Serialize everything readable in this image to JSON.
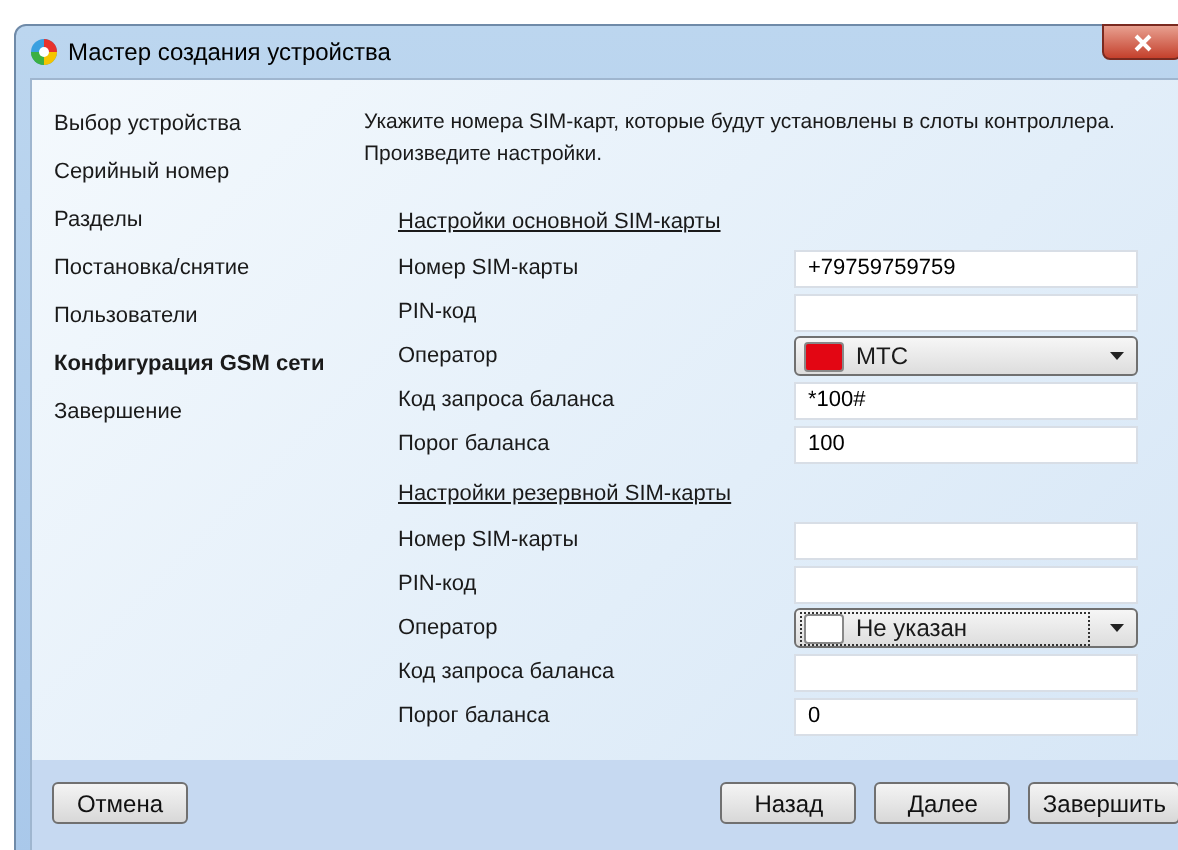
{
  "window": {
    "title": "Мастер создания устройства"
  },
  "sidebar": {
    "items": [
      {
        "label": "Выбор устройства",
        "selected": false
      },
      {
        "label": "Серийный номер",
        "selected": false
      },
      {
        "label": "Разделы",
        "selected": false
      },
      {
        "label": "Постановка/снятие",
        "selected": false
      },
      {
        "label": "Пользователи",
        "selected": false
      },
      {
        "label": "Конфигурация GSM сети",
        "selected": true
      },
      {
        "label": "Завершение",
        "selected": false
      }
    ]
  },
  "instructions": [
    "Укажите номера SIM-карт, которые будут установлены в слоты контроллера.",
    "Произведите настройки."
  ],
  "sections": [
    {
      "title": "Настройки основной SIM-карты",
      "fields": [
        {
          "kind": "text",
          "label": "Номер SIM-карты",
          "value": "+79759759759"
        },
        {
          "kind": "text",
          "label": "PIN-код"
        },
        {
          "kind": "select",
          "label": "Оператор",
          "value": "МТС",
          "color": "#e30613",
          "focused": false
        },
        {
          "kind": "text",
          "label": "Код запроса баланса",
          "value": "*100#"
        },
        {
          "kind": "text",
          "label": "Порог баланса",
          "value": "100"
        }
      ]
    },
    {
      "title": "Настройки резервной SIM-карты",
      "fields": [
        {
          "kind": "text",
          "label": "Номер SIM-карты"
        },
        {
          "kind": "text",
          "label": "PIN-код"
        },
        {
          "kind": "select",
          "label": "Оператор",
          "value": "Не указан",
          "color": "#ffffff",
          "focused": true
        },
        {
          "kind": "text",
          "label": "Код запроса баланса"
        },
        {
          "kind": "text",
          "label": "Порог баланса",
          "value": "0"
        }
      ]
    }
  ],
  "buttons": {
    "left": [
      "Отмена"
    ],
    "right": [
      "Назад",
      "Далее",
      "Завершить"
    ]
  }
}
